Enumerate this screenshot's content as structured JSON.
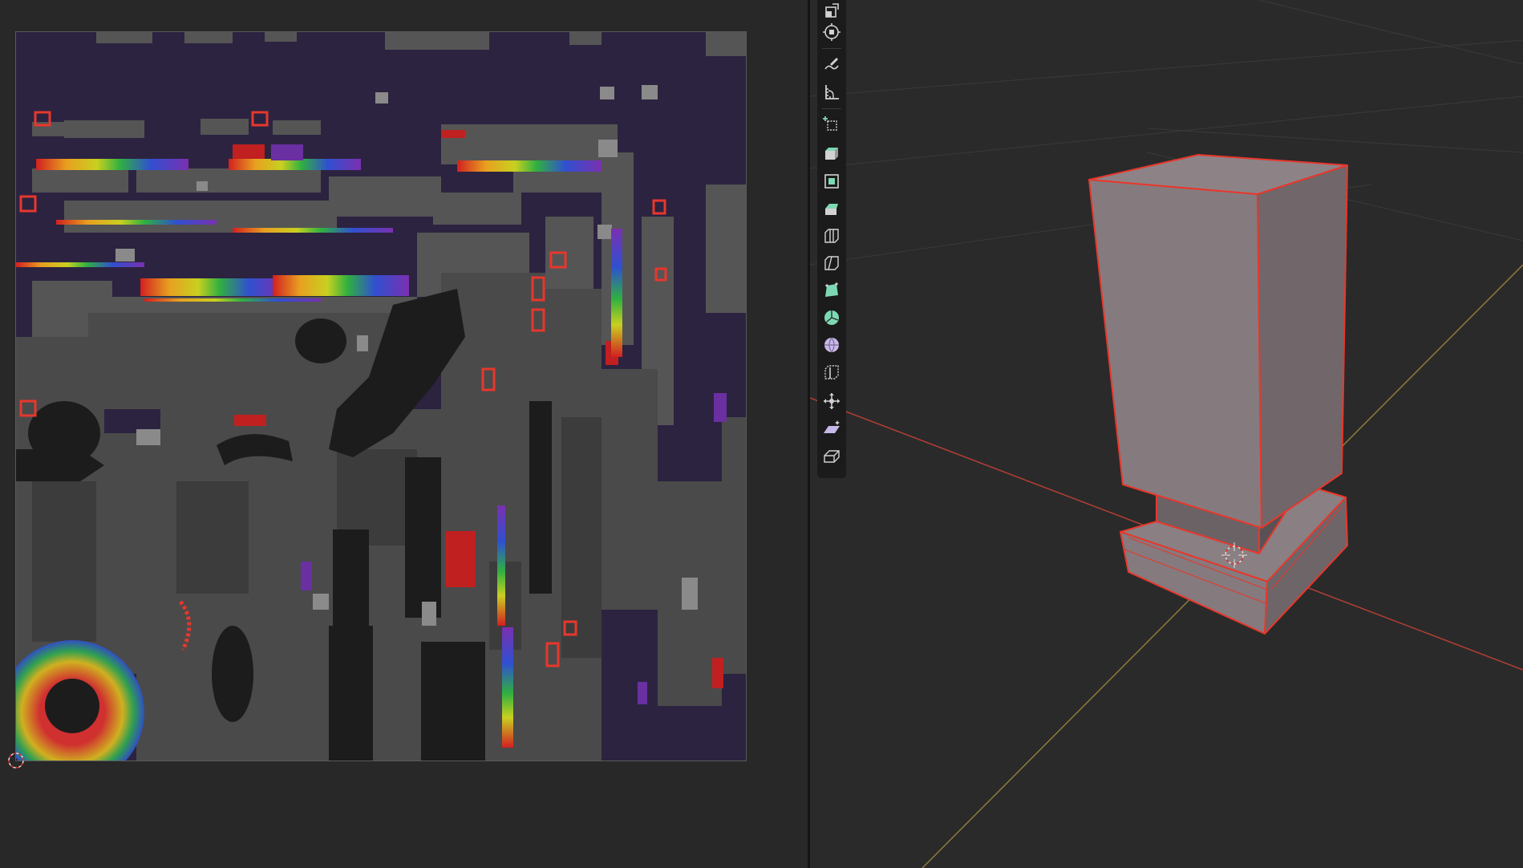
{
  "app": "3D editor",
  "uv_editor": {
    "texture": "uv-checker-pattern",
    "cursor_icon": "uv-cursor-icon"
  },
  "viewport": {
    "object": "box-mesh",
    "selection_color": "#e8372c",
    "x_axis_color": "#b33e35",
    "y_axis_color": "#8f7a3c",
    "cursor_icon": "3d-cursor-icon"
  },
  "toolbar": {
    "tools": [
      "scale-icon",
      "transform-icon",
      "annotate-icon",
      "measure-icon",
      "add-cube-icon",
      "extrude-region-icon",
      "inset-faces-icon",
      "bevel-icon",
      "loop-cut-icon",
      "knife-icon",
      "poly-build-icon",
      "spin-icon",
      "smooth-icon",
      "edge-slide-icon",
      "shrink-fatten-icon",
      "shear-icon",
      "rip-region-icon"
    ],
    "colors": {
      "icon": "#d2d2d2",
      "highlight": "#7dd9b3",
      "accent": "#c8b8e8"
    }
  }
}
